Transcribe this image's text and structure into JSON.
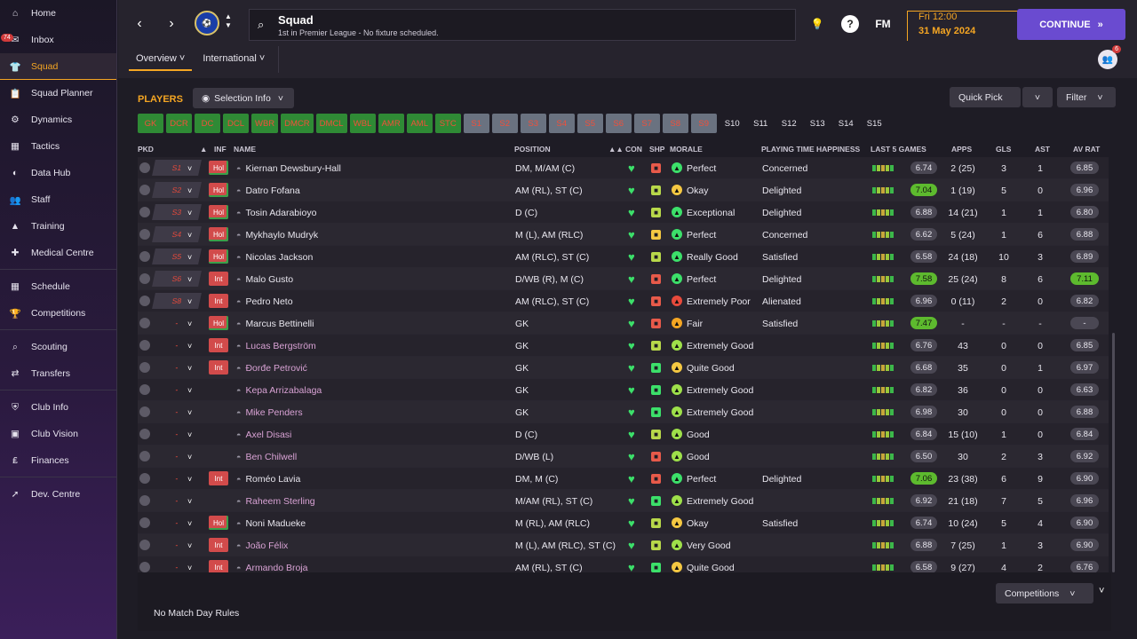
{
  "sidebar": {
    "inbox_badge": "74",
    "items": [
      {
        "label": "Home",
        "icon": "home-icon"
      },
      {
        "label": "Inbox",
        "icon": "inbox-icon"
      },
      {
        "label": "Squad",
        "icon": "shirt-icon"
      },
      {
        "label": "Squad Planner",
        "icon": "clipboard-icon"
      },
      {
        "label": "Dynamics",
        "icon": "network-icon"
      },
      {
        "label": "Tactics",
        "icon": "tactics-icon"
      },
      {
        "label": "Data Hub",
        "icon": "data-icon"
      },
      {
        "label": "Staff",
        "icon": "staff-icon"
      },
      {
        "label": "Training",
        "icon": "training-icon"
      },
      {
        "label": "Medical Centre",
        "icon": "medical-icon"
      },
      {
        "label": "Schedule",
        "icon": "calendar-icon"
      },
      {
        "label": "Competitions",
        "icon": "trophy-icon"
      },
      {
        "label": "Scouting",
        "icon": "search-icon"
      },
      {
        "label": "Transfers",
        "icon": "transfer-icon"
      },
      {
        "label": "Club Info",
        "icon": "shield-icon"
      },
      {
        "label": "Club Vision",
        "icon": "briefcase-icon"
      },
      {
        "label": "Finances",
        "icon": "money-icon"
      },
      {
        "label": "Dev. Centre",
        "icon": "dev-icon"
      }
    ]
  },
  "header": {
    "title": "Squad",
    "subtitle": "1st in Premier League - No fixture scheduled.",
    "date_line1": "Fri 12:00",
    "date_line2": "31 May 2024",
    "continue_label": "CONTINUE",
    "fm_label": "FM",
    "help_label": "?",
    "avatar_badge": "6",
    "tabs": [
      "Overview",
      "International"
    ]
  },
  "toolbar": {
    "players_label": "PLAYERS",
    "selection_info": "Selection Info",
    "quick_pick": "Quick Pick",
    "filter": "Filter"
  },
  "positions": [
    "GK",
    "DCR",
    "DC",
    "DCL",
    "WBR",
    "DMCR",
    "DMCL",
    "WBL",
    "AMR",
    "AML",
    "STC",
    "S1",
    "S2",
    "S3",
    "S4",
    "S5",
    "S6",
    "S7",
    "S8",
    "S9",
    "S10",
    "S11",
    "S12",
    "S13",
    "S14",
    "S15"
  ],
  "columns": {
    "pkd": "PKD",
    "inf": "INF",
    "name": "NAME",
    "position": "POSITION",
    "con": "CON",
    "shp": "SHP",
    "morale": "MORALE",
    "pth": "PLAYING TIME HAPPINESS",
    "last5": "LAST 5 GAMES",
    "apps": "APPS",
    "gls": "GLS",
    "ast": "AST",
    "avrat": "AV RAT"
  },
  "players": [
    {
      "sel": "S1",
      "inf": "Hol",
      "name": "Kiernan Dewsbury-Hall",
      "pos": "DM, M/AM (C)",
      "morale": "Perfect",
      "pth": "Concerned",
      "rating": "6.74",
      "apps": "2 (25)",
      "gls": "3",
      "ast": "1",
      "avr": "6.85"
    },
    {
      "sel": "S2",
      "inf": "Hol",
      "name": "Datro Fofana",
      "pos": "AM (RL), ST (C)",
      "morale": "Okay",
      "pth": "Delighted",
      "rating": "7.04",
      "apps": "1 (19)",
      "gls": "5",
      "ast": "0",
      "avr": "6.96"
    },
    {
      "sel": "S3",
      "inf": "Hol",
      "name": "Tosin Adarabioyo",
      "pos": "D (C)",
      "morale": "Exceptional",
      "pth": "Delighted",
      "rating": "6.88",
      "apps": "14 (21)",
      "gls": "1",
      "ast": "1",
      "avr": "6.80"
    },
    {
      "sel": "S4",
      "inf": "Hol",
      "name": "Mykhaylo Mudryk",
      "pos": "M (L), AM (RLC)",
      "morale": "Perfect",
      "pth": "Concerned",
      "rating": "6.62",
      "apps": "5 (24)",
      "gls": "1",
      "ast": "6",
      "avr": "6.88"
    },
    {
      "sel": "S5",
      "inf": "Hol",
      "name": "Nicolas Jackson",
      "pos": "AM (RLC), ST (C)",
      "morale": "Really Good",
      "pth": "Satisfied",
      "rating": "6.58",
      "apps": "24 (18)",
      "gls": "10",
      "ast": "3",
      "avr": "6.89"
    },
    {
      "sel": "S6",
      "inf": "Int",
      "name": "Malo Gusto",
      "pos": "D/WB (R), M (C)",
      "morale": "Perfect",
      "pth": "Delighted",
      "rating": "7.58",
      "apps": "25 (24)",
      "gls": "8",
      "ast": "6",
      "avr": "7.11"
    },
    {
      "sel": "S8",
      "inf": "Int",
      "name": "Pedro Neto",
      "pos": "AM (RLC), ST (C)",
      "morale": "Extremely Poor",
      "pth": "Alienated",
      "rating": "6.96",
      "apps": "0 (11)",
      "gls": "2",
      "ast": "0",
      "avr": "6.82"
    },
    {
      "sel": "-",
      "inf": "Hol",
      "name": "Marcus Bettinelli",
      "pos": "GK",
      "morale": "Fair",
      "pth": "Satisfied",
      "rating": "7.47",
      "apps": "-",
      "gls": "-",
      "ast": "-",
      "avr": "-"
    },
    {
      "sel": "-",
      "inf": "Int",
      "name": "Lucas Bergström",
      "pos": "GK",
      "morale": "Extremely Good",
      "pth": "",
      "rating": "6.76",
      "apps": "43",
      "gls": "0",
      "ast": "0",
      "avr": "6.85"
    },
    {
      "sel": "-",
      "inf": "Int",
      "name": "Đorđe Petrović",
      "pos": "GK",
      "morale": "Quite Good",
      "pth": "",
      "rating": "6.68",
      "apps": "35",
      "gls": "0",
      "ast": "1",
      "avr": "6.97"
    },
    {
      "sel": "-",
      "inf": "",
      "name": "Kepa Arrizabalaga",
      "pos": "GK",
      "morale": "Extremely Good",
      "pth": "",
      "rating": "6.82",
      "apps": "36",
      "gls": "0",
      "ast": "0",
      "avr": "6.63"
    },
    {
      "sel": "-",
      "inf": "",
      "name": "Mike Penders",
      "pos": "GK",
      "morale": "Extremely Good",
      "pth": "",
      "rating": "6.98",
      "apps": "30",
      "gls": "0",
      "ast": "0",
      "avr": "6.88"
    },
    {
      "sel": "-",
      "inf": "",
      "name": "Axel Disasi",
      "pos": "D (C)",
      "morale": "Good",
      "pth": "",
      "rating": "6.84",
      "apps": "15 (10)",
      "gls": "1",
      "ast": "0",
      "avr": "6.84"
    },
    {
      "sel": "-",
      "inf": "",
      "name": "Ben Chilwell",
      "pos": "D/WB (L)",
      "morale": "Good",
      "pth": "",
      "rating": "6.50",
      "apps": "30",
      "gls": "2",
      "ast": "3",
      "avr": "6.92"
    },
    {
      "sel": "-",
      "inf": "Int",
      "name": "Roméo Lavia",
      "pos": "DM, M (C)",
      "morale": "Perfect",
      "pth": "Delighted",
      "rating": "7.06",
      "apps": "23 (38)",
      "gls": "6",
      "ast": "9",
      "avr": "6.90"
    },
    {
      "sel": "-",
      "inf": "",
      "name": "Raheem Sterling",
      "pos": "M/AM (RL), ST (C)",
      "morale": "Extremely Good",
      "pth": "",
      "rating": "6.92",
      "apps": "21 (18)",
      "gls": "7",
      "ast": "5",
      "avr": "6.96"
    },
    {
      "sel": "-",
      "inf": "Hol",
      "name": "Noni Madueke",
      "pos": "M (RL), AM (RLC)",
      "morale": "Okay",
      "pth": "Satisfied",
      "rating": "6.74",
      "apps": "10 (24)",
      "gls": "5",
      "ast": "4",
      "avr": "6.90"
    },
    {
      "sel": "-",
      "inf": "Int",
      "name": "João Félix",
      "pos": "M (L), AM (RLC), ST (C)",
      "morale": "Very Good",
      "pth": "",
      "rating": "6.88",
      "apps": "7 (25)",
      "gls": "1",
      "ast": "3",
      "avr": "6.90"
    },
    {
      "sel": "-",
      "inf": "Int",
      "name": "Armando Broja",
      "pos": "AM (RL), ST (C)",
      "morale": "Quite Good",
      "pth": "",
      "rating": "6.58",
      "apps": "9 (27)",
      "gls": "4",
      "ast": "2",
      "avr": "6.76"
    }
  ],
  "footer": {
    "competitions": "Competitions",
    "match_day_rules": "No Match Day Rules"
  },
  "colors": {
    "accent": "#f5a623",
    "continue": "#6a4bd0",
    "good": "#3ce06a",
    "bad": "#e84a3c"
  }
}
